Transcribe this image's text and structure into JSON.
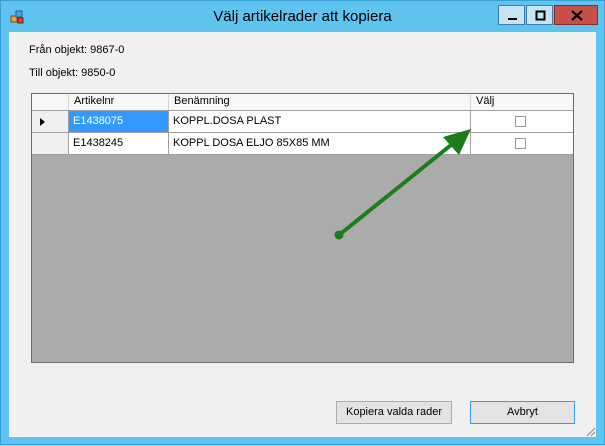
{
  "window": {
    "title": "Välj artikelrader att kopiera",
    "controls": {
      "minimize": "minimize",
      "maximize": "maximize",
      "close": "close"
    }
  },
  "info": {
    "from": "Från objekt: 9867-0",
    "to": "Till objekt: 9850-0"
  },
  "grid": {
    "columns": [
      "Artikelnr",
      "Benämning",
      "Välj"
    ],
    "rows": [
      {
        "artikelnr": "E1438075",
        "benamning": "KOPPL.DOSA PLAST",
        "valj": false,
        "current": true
      },
      {
        "artikelnr": "E1438245",
        "benamning": "KOPPL DOSA ELJO 85X85 MM",
        "valj": false,
        "current": false
      }
    ]
  },
  "buttons": {
    "copy": "Kopiera valda rader",
    "cancel": "Avbryt"
  },
  "colors": {
    "window_frame": "#5ec3ee",
    "selection": "#3399ff",
    "grid_background": "#ababab",
    "annotation_arrow": "#1a7f1a"
  }
}
